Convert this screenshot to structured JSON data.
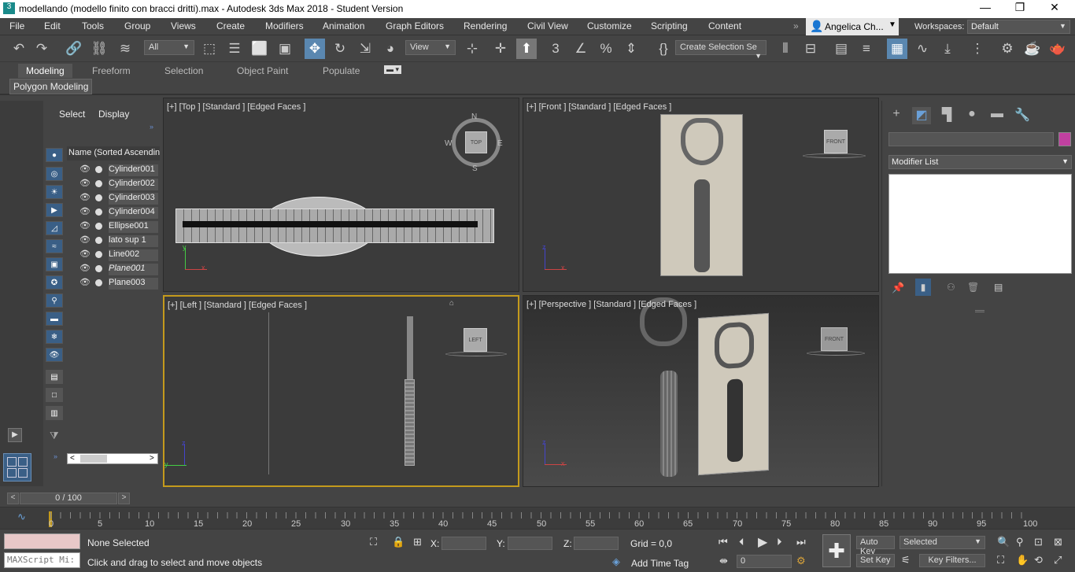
{
  "window": {
    "title": "modellando (modello finito con bracci dritti).max - Autodesk 3ds Max 2018 - Student Version"
  },
  "menu": [
    "File",
    "Edit",
    "Tools",
    "Group",
    "Views",
    "Create",
    "Modifiers",
    "Animation",
    "Graph Editors",
    "Rendering",
    "Civil View",
    "Customize",
    "Scripting",
    "Content"
  ],
  "user": {
    "name": "Angelica Ch...",
    "workspaces_label": "Workspaces:",
    "workspace": "Default"
  },
  "toolbar": {
    "filter": "All",
    "ref_coord": "View",
    "selection_set": "Create Selection Se"
  },
  "ribbon": {
    "tabs": [
      "Modeling",
      "Freeform",
      "Selection",
      "Object Paint",
      "Populate"
    ],
    "panel": "Polygon Modeling"
  },
  "scene_explorer": {
    "tabs": [
      "Select",
      "Display"
    ],
    "header": "Name (Sorted Ascending",
    "objects": [
      "Cylinder001",
      "Cylinder002",
      "Cylinder003",
      "Cylinder004",
      "Ellipse001",
      "lato sup 1",
      "Line002",
      "Plane001",
      "Plane003"
    ]
  },
  "viewports": {
    "top": "[+] [Top ] [Standard ] [Edged Faces ]",
    "front": "[+] [Front ] [Standard ] [Edged Faces ]",
    "left": "[+] [Left ] [Standard ] [Edged Faces ]",
    "perspective": "[+] [Perspective ] [Standard ] [Edged Faces ]",
    "viewcube_top": "TOP",
    "viewcube_front": "FRONT",
    "viewcube_left": "LEFT",
    "viewcube_persp": "FRONT",
    "compass": {
      "n": "N",
      "s": "S",
      "e": "E",
      "w": "W"
    },
    "axis_x": "x",
    "axis_y": "y",
    "axis_z": "z"
  },
  "command_panel": {
    "modifier_list": "Modifier List"
  },
  "timeline": {
    "frame": "0 / 100",
    "ticks": [
      "0",
      "5",
      "10",
      "15",
      "20",
      "25",
      "30",
      "35",
      "40",
      "45",
      "50",
      "55",
      "60",
      "65",
      "70",
      "75",
      "80",
      "85",
      "90",
      "95",
      "100"
    ]
  },
  "status": {
    "maxscript": "MAXScript Mi:",
    "selected": "None Selected",
    "prompt": "Click and drag to select and move objects",
    "x_label": "X:",
    "y_label": "Y:",
    "z_label": "Z:",
    "grid": "Grid = 0,0",
    "add_time_tag": "Add Time Tag",
    "auto_key": "Auto Key",
    "set_key": "Set Key",
    "key_mode": "Selected",
    "key_filters": "Key Filters...",
    "frame": "0"
  },
  "colors": {
    "accent": "#5a87b0",
    "active_viewport": "#c49a1c",
    "object_color": "#c040a0"
  }
}
